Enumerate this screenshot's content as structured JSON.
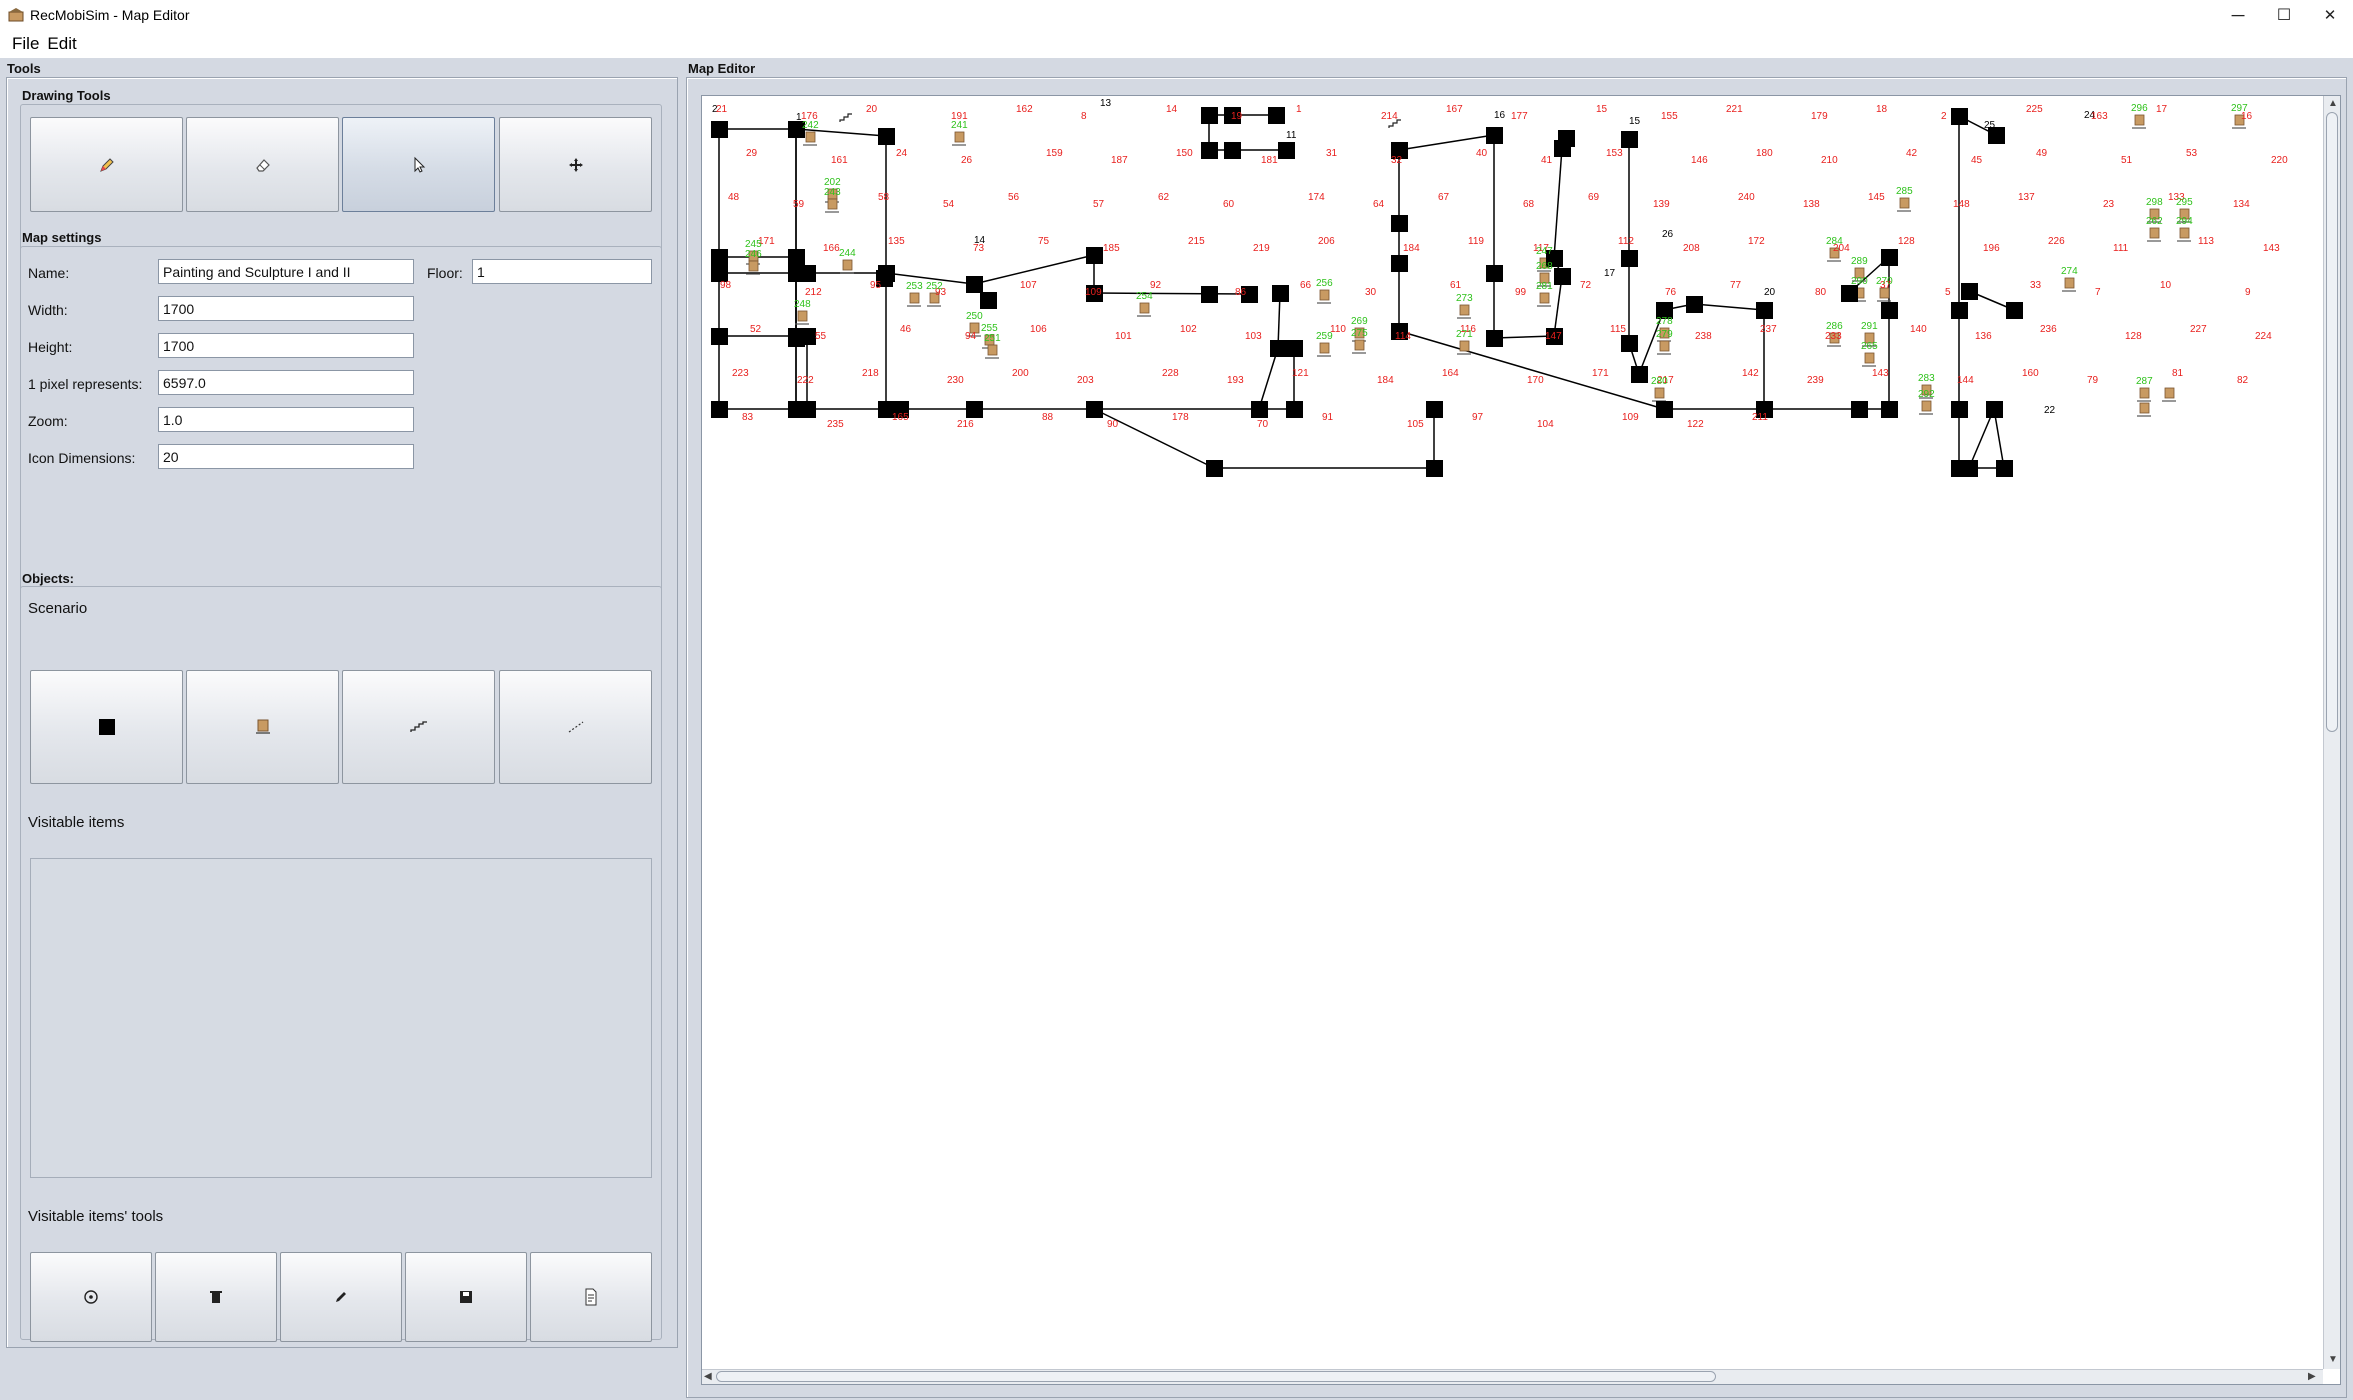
{
  "window": {
    "title": "RecMobiSim - Map Editor",
    "min_glyph": "─",
    "max_glyph": "☐",
    "close_glyph": "✕"
  },
  "menu": {
    "items": [
      "File",
      "Edit"
    ]
  },
  "tools_panel": {
    "title": "Tools",
    "drawing_tools": {
      "title": "Drawing Tools",
      "buttons": [
        {
          "icon": "pencil-icon",
          "selected": false
        },
        {
          "icon": "eraser-icon",
          "selected": false
        },
        {
          "icon": "pointer-icon",
          "selected": true
        },
        {
          "icon": "move-icon",
          "selected": false
        }
      ]
    },
    "map_settings": {
      "title": "Map settings",
      "name_label": "Name:",
      "name_value": "Painting and Sculpture I and II",
      "floor_label": "Floor:",
      "floor_value": "1",
      "width_label": "Width:",
      "width_value": "1700",
      "height_label": "Height:",
      "height_value": "1700",
      "pixel_label": "1 pixel represents:",
      "pixel_value": "6597.0",
      "zoom_label": "Zoom:",
      "zoom_value": "1.0",
      "icon_dim_label": "Icon Dimensions:",
      "icon_dim_value": "20"
    },
    "objects": {
      "title": "Objects:",
      "scenario_label": "Scenario",
      "buttons": [
        {
          "icon": "node-square-icon"
        },
        {
          "icon": "artwork-pedestal-icon"
        },
        {
          "icon": "stairs-icon"
        },
        {
          "icon": "dashed-line-icon"
        }
      ],
      "visitable_items_label": "Visitable items",
      "visitable_tools_label": "Visitable items' tools",
      "item_tool_buttons": [
        {
          "icon": "add-circle-icon"
        },
        {
          "icon": "trash-icon"
        },
        {
          "icon": "edit-pencil-icon"
        },
        {
          "icon": "save-disk-icon"
        },
        {
          "icon": "document-icon"
        }
      ]
    }
  },
  "editor": {
    "title": "Map Editor",
    "colors": {
      "node": "#000000",
      "link_label": "#e8201e",
      "item_label": "#2fc21c",
      "node_label": "#000000",
      "pedestal": "#c89a62"
    },
    "node_labels": [
      "2",
      "1",
      "13",
      "11",
      "16",
      "15",
      "14",
      "26",
      "25",
      "24",
      "17",
      "20",
      "8",
      "22"
    ],
    "link_labels": [
      "21",
      "176",
      "20",
      "191",
      "162",
      "8",
      "14",
      "19",
      "1",
      "214",
      "167",
      "177",
      "15",
      "155",
      "221",
      "179",
      "18",
      "2",
      "225",
      "163",
      "17",
      "16",
      "29",
      "161",
      "24",
      "26",
      "159",
      "187",
      "150",
      "181",
      "31",
      "32",
      "40",
      "41",
      "153",
      "146",
      "180",
      "210",
      "42",
      "45",
      "49",
      "51",
      "53",
      "220",
      "48",
      "59",
      "58",
      "54",
      "56",
      "57",
      "62",
      "60",
      "174",
      "64",
      "67",
      "68",
      "69",
      "139",
      "240",
      "138",
      "145",
      "148",
      "137",
      "23",
      "133",
      "134",
      "171",
      "166",
      "135",
      "73",
      "75",
      "185",
      "215",
      "219",
      "206",
      "184",
      "119",
      "117",
      "112",
      "208",
      "172",
      "204",
      "128",
      "196",
      "226",
      "111",
      "113",
      "143",
      "98",
      "212",
      "95",
      "93",
      "107",
      "109",
      "92",
      "86",
      "66",
      "30",
      "61",
      "99",
      "72",
      "76",
      "77",
      "80",
      "37",
      "5",
      "33",
      "7",
      "10",
      "9",
      "52",
      "55",
      "46",
      "94",
      "106",
      "101",
      "102",
      "103",
      "110",
      "114",
      "116",
      "147",
      "115",
      "238",
      "237",
      "233",
      "140",
      "136",
      "236",
      "128",
      "227",
      "224",
      "223",
      "222",
      "218",
      "230",
      "200",
      "203",
      "228",
      "193",
      "121",
      "184",
      "164",
      "170",
      "171",
      "217",
      "142",
      "239",
      "143",
      "144",
      "160",
      "79",
      "81",
      "82",
      "83",
      "235",
      "165",
      "216",
      "88",
      "90",
      "178",
      "70",
      "91",
      "105",
      "97",
      "104",
      "109",
      "122",
      "211"
    ],
    "item_labels": [
      "242",
      "241",
      "202",
      "243",
      "245",
      "246",
      "244",
      "252",
      "253",
      "248",
      "250",
      "255",
      "251",
      "254",
      "256",
      "259",
      "269",
      "275",
      "273",
      "271",
      "247",
      "268",
      "281",
      "278",
      "279",
      "280",
      "284",
      "286",
      "289",
      "290",
      "270",
      "285",
      "283",
      "292",
      "291",
      "265",
      "296",
      "297",
      "298",
      "262",
      "295",
      "294",
      "274",
      "287"
    ]
  }
}
